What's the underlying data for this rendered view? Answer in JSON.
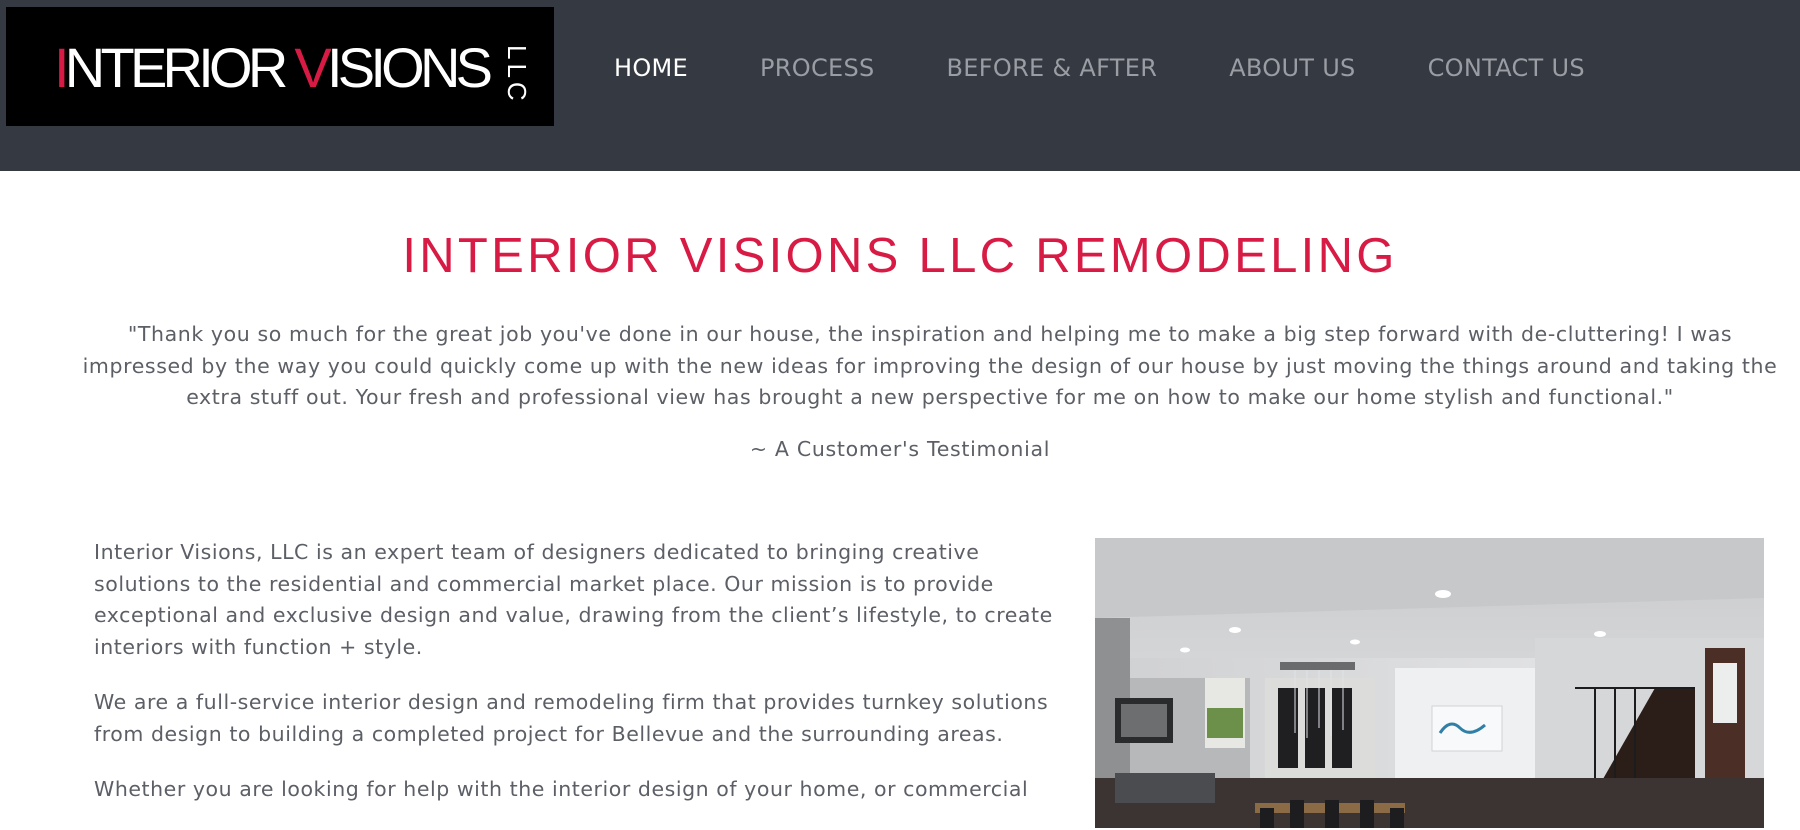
{
  "brand": {
    "logo_text": "INTERIOR VISIONS LLC",
    "logo_text_color": "#ffffff",
    "logo_accent_color": "#d81b45"
  },
  "nav": {
    "items": [
      {
        "label": "HOME",
        "active": true
      },
      {
        "label": "PROCESS",
        "active": false
      },
      {
        "label": "BEFORE & AFTER",
        "active": false
      },
      {
        "label": "ABOUT US",
        "active": false
      },
      {
        "label": "CONTACT US",
        "active": false
      }
    ]
  },
  "main": {
    "title": "INTERIOR VISIONS LLC REMODELING",
    "testimonial": "\"Thank you so much for the great job you've done in our house, the inspiration and helping me to make a big step forward with de-cluttering! I was impressed by the way you could quickly come up with the new ideas for improving the design of our house by just moving the things around and taking the extra stuff out. Your fresh and professional view has brought a new perspective for me on how to make our home stylish and functional.\"",
    "attribution": "~ A Customer's Testimonial",
    "paragraphs": [
      "Interior Visions, LLC is an expert team of designers dedicated to bringing creative solutions to the residential and commercial market place. Our mission is to provide exceptional and exclusive design and value, drawing from the client’s lifestyle, to create interiors with function + style.",
      "We are a full-service interior design and remodeling firm that provides turnkey solutions from design to building a completed project for Bellevue and the surrounding areas.",
      "Whether you are looking for help with the interior design of your home, or commercial"
    ]
  },
  "colors": {
    "header_bg": "#353941",
    "title_red": "#d81b45",
    "body_text": "#5c5f66",
    "nav_inactive": "#9a9da3"
  }
}
